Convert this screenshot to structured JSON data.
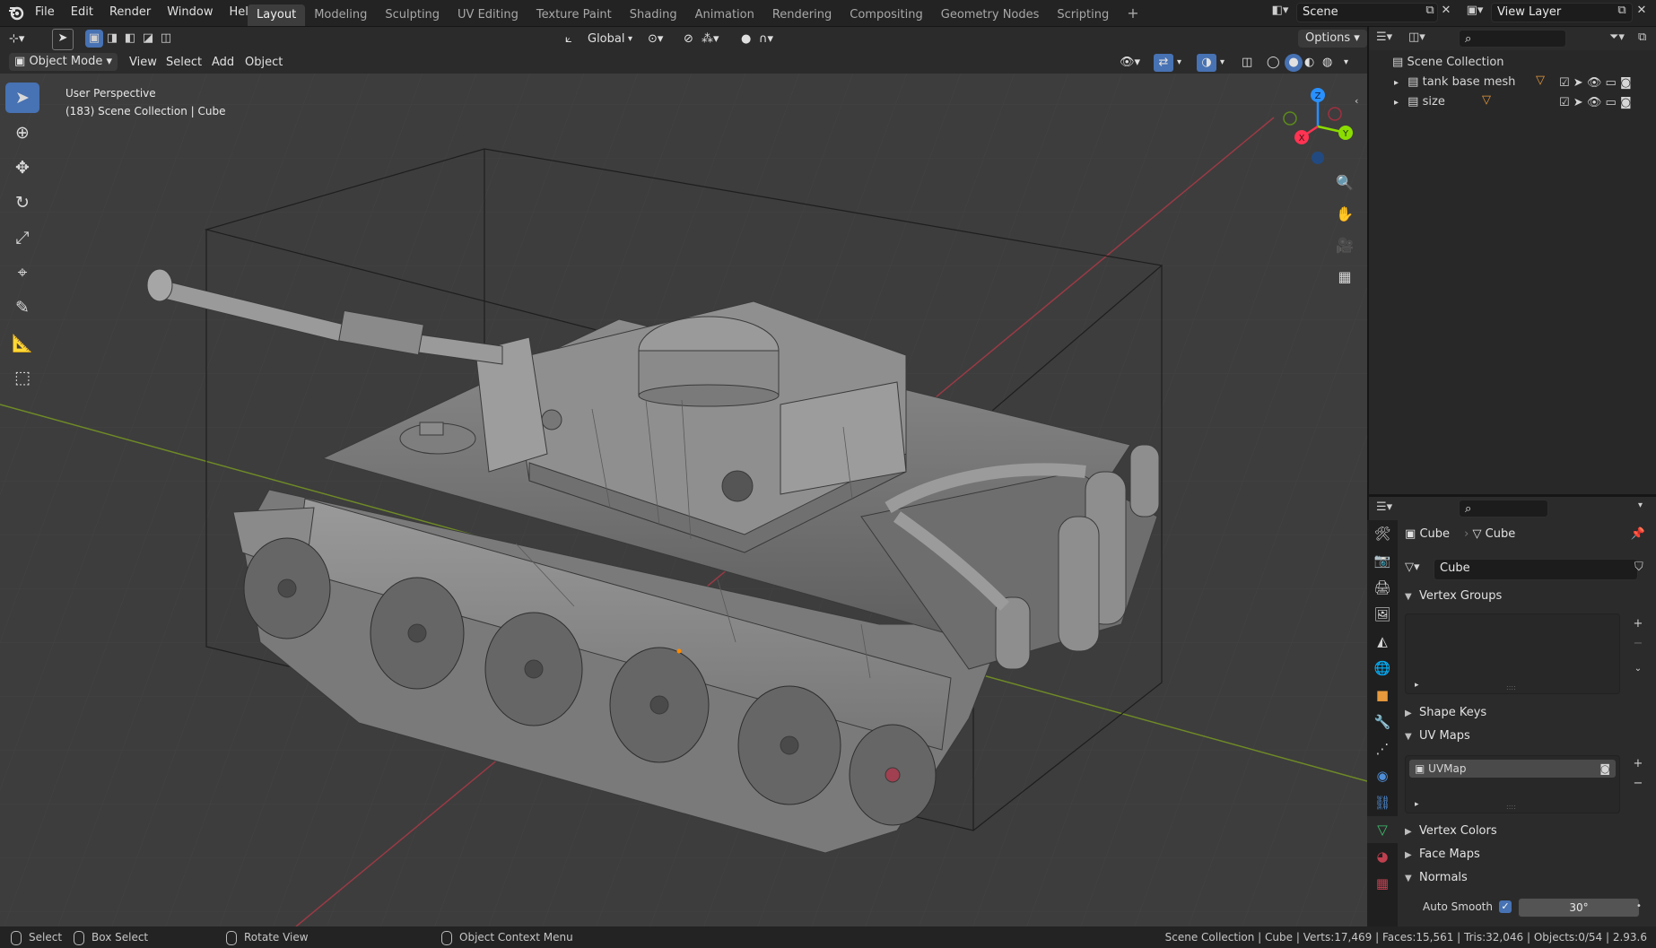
{
  "menu": {
    "items": [
      "File",
      "Edit",
      "Render",
      "Window",
      "Help"
    ]
  },
  "workspaces": {
    "tabs": [
      "Layout",
      "Modeling",
      "Sculpting",
      "UV Editing",
      "Texture Paint",
      "Shading",
      "Animation",
      "Rendering",
      "Compositing",
      "Geometry Nodes",
      "Scripting"
    ],
    "active": "Layout"
  },
  "scene": {
    "name": "Scene",
    "view_layer": "View Layer"
  },
  "viewport": {
    "mode": "Object Mode",
    "menus": [
      "View",
      "Select",
      "Add",
      "Object"
    ],
    "transform_orientation": "Global",
    "options_label": "Options",
    "overlay_title": "User Perspective",
    "overlay_subtitle": "(183) Scene Collection | Cube",
    "gizmo": {
      "x": "X",
      "y": "Y",
      "z": "Z"
    }
  },
  "outliner": {
    "root": "Scene Collection",
    "items": [
      {
        "label": "tank base mesh"
      },
      {
        "label": "size"
      }
    ]
  },
  "properties": {
    "breadcrumb_object": "Cube",
    "breadcrumb_data": "Cube",
    "mesh_name": "Cube",
    "sections": {
      "vertex_groups": "Vertex Groups",
      "shape_keys": "Shape Keys",
      "uv_maps": "UV Maps",
      "vertex_colors": "Vertex Colors",
      "face_maps": "Face Maps",
      "normals": "Normals"
    },
    "uv_map_item": "UVMap",
    "auto_smooth_label": "Auto Smooth",
    "auto_smooth_angle": "30°"
  },
  "statusbar": {
    "select": "Select",
    "box_select": "Box Select",
    "rotate_view": "Rotate View",
    "context_menu": "Object Context Menu",
    "stats": "Scene Collection | Cube | Verts:17,469 | Faces:15,561 | Tris:32,046 | Objects:0/54 | 2.93.6"
  },
  "colors": {
    "accent": "#4772b3",
    "x_axis": "#ff3352",
    "y_axis": "#8bdc00",
    "z_axis": "#2890ff"
  }
}
